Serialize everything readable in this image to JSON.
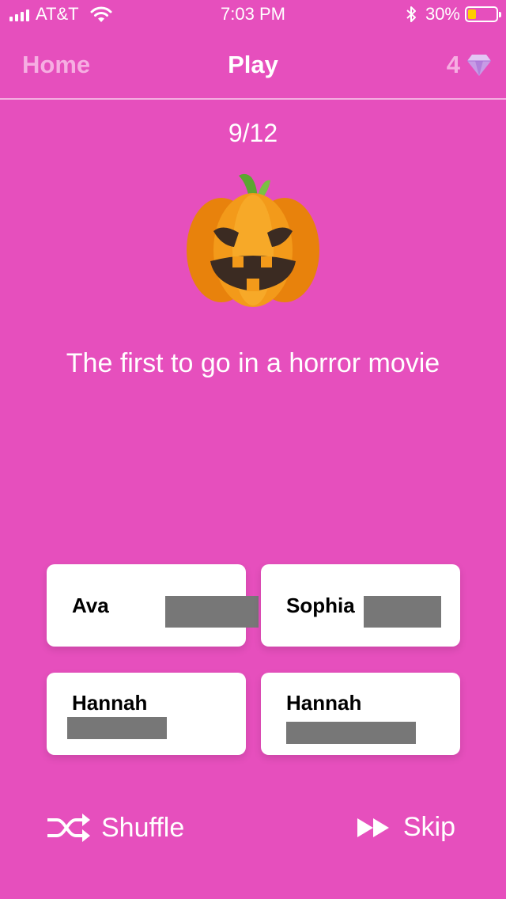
{
  "status_bar": {
    "carrier": "AT&T",
    "time": "7:03 PM",
    "battery_percent": "30%",
    "battery_level": 0.3,
    "battery_color": "#ffcc00"
  },
  "nav": {
    "home_label": "Home",
    "title": "Play",
    "gems_count": "4"
  },
  "progress": "9/12",
  "question": "The first to go in a horror movie",
  "options": [
    {
      "line1": "Ava"
    },
    {
      "line1": "Sophia"
    },
    {
      "line1": "Hannah"
    },
    {
      "line1": "Hannah"
    }
  ],
  "actions": {
    "shuffle_label": "Shuffle",
    "skip_label": "Skip"
  },
  "colors": {
    "background": "#e64fbd",
    "home_text": "#f6aee2"
  }
}
